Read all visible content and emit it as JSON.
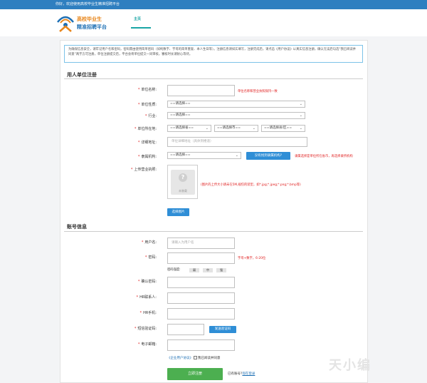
{
  "topbar": {
    "text": "你好，欢迎使用高校毕业生精准招聘平台"
  },
  "header": {
    "logo_line1": "高校毕业生",
    "logo_line2": "精准招聘平台",
    "nav_home": "主页"
  },
  "notice": {
    "text": "为确保信息安全，请牢记用户名和密码，密码需由使用简单密码（如纯数字、字母的简单重复、本人生日等）。注册信息请如实填写，注册完成后，请点击《用户协议》以真实信息注册，确认无误后勾选“我已阅读并同意”两字方可注册，单位注册提交后，平台会将单位提交一同审核，審核时长请耐心等待。"
  },
  "section_unit": {
    "title": "用人单位注册",
    "unit_name": {
      "label": "单位名称:",
      "hint": "单位名称和营业执照保持一致"
    },
    "unit_nature": {
      "label": "单位性质:",
      "selected": "==请选择=="
    },
    "industry": {
      "label": "行业:",
      "selected": "==请选择=="
    },
    "location": {
      "label": "单位所在地:",
      "province": "==请选择省==",
      "city": "==请选择市==",
      "district": "==请选择县/区=="
    },
    "address": {
      "label": "详细地址:",
      "placeholder": "单位详细地址（具体到楼道）"
    },
    "agency": {
      "label": "隶属机构:",
      "selected": "==请选择==",
      "button": "没有找到隶属机构?",
      "hint": "隶属选择是单位所在省市，再选择隶所机构"
    },
    "license": {
      "label": "上传营业执照:",
      "placeholder_text": "未装载",
      "hint": "(图片的上传大小请未在5M,规仅的装型，如*.jpg;*.jpeg;*.png;*.bmp等)",
      "button": "选择图片"
    }
  },
  "section_account": {
    "title": "账号信息",
    "username": {
      "label": "用户名:",
      "placeholder": "请输入为用户名"
    },
    "password": {
      "label": "密码:",
      "hint": "字母+数字，6-20位"
    },
    "strength": {
      "label": "密码强度:",
      "levels": [
        "弱",
        "中",
        "强"
      ]
    },
    "confirm_password": {
      "label": "确认密码:"
    },
    "hr_contact": {
      "label": "HR联系人:"
    },
    "hr_phone": {
      "label": "HR手机:"
    },
    "sms_code": {
      "label": "短信验证码:",
      "button": "发送验证码"
    },
    "email": {
      "label": "电子邮箱:"
    }
  },
  "agreement": {
    "link": "《企业用户协议》",
    "text": "我已阅读并同意"
  },
  "submit": {
    "label": "立即注册"
  },
  "login": {
    "text": "已有账号?",
    "link": "现在登录"
  },
  "watermark": {
    "text": "天小编"
  },
  "colors": {
    "topbar": "#2f7fc0",
    "accent_teal": "#1aa6a6",
    "required": "#e02020",
    "button_blue": "#2f8ed6",
    "submit_green": "#4caf50"
  }
}
